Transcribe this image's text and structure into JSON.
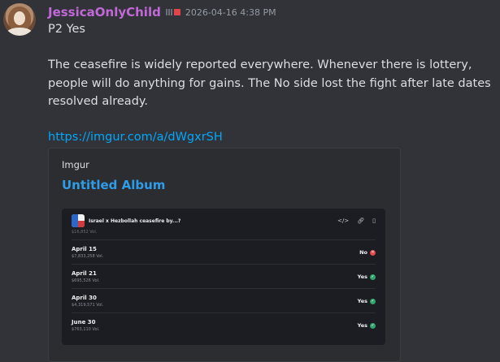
{
  "message": {
    "username": "JessicaOnlyChild",
    "timestamp": "2026-04-16 4:38 PM",
    "line1": "P2 Yes",
    "paragraph_lines": [
      "The ceasefire is widely reported everywhere. Whenever there is lottery,",
      "people will do anything for gains. The No side lost the fight after late dates",
      "resolved already."
    ],
    "link": "https://imgur.com/a/dWgxrSH"
  },
  "embed": {
    "provider": "Imgur",
    "title": "Untitled Album",
    "market": {
      "title": "Israel x Hezbollah ceasefire by...?",
      "ghost_text": "$16,852 Vol.",
      "rows": [
        {
          "date": "April 15",
          "volume": "$7,833,258 Vol.",
          "result": "No",
          "color": "#e5484d"
        },
        {
          "date": "April 21",
          "volume": "$695,526 Vol.",
          "result": "Yes",
          "color": "#30a46c"
        },
        {
          "date": "April 30",
          "volume": "$4,319,571 Vol.",
          "result": "Yes",
          "color": "#30a46c"
        },
        {
          "date": "June 30",
          "volume": "$763,110 Vol.",
          "result": "Yes",
          "color": "#30a46c"
        }
      ]
    }
  }
}
